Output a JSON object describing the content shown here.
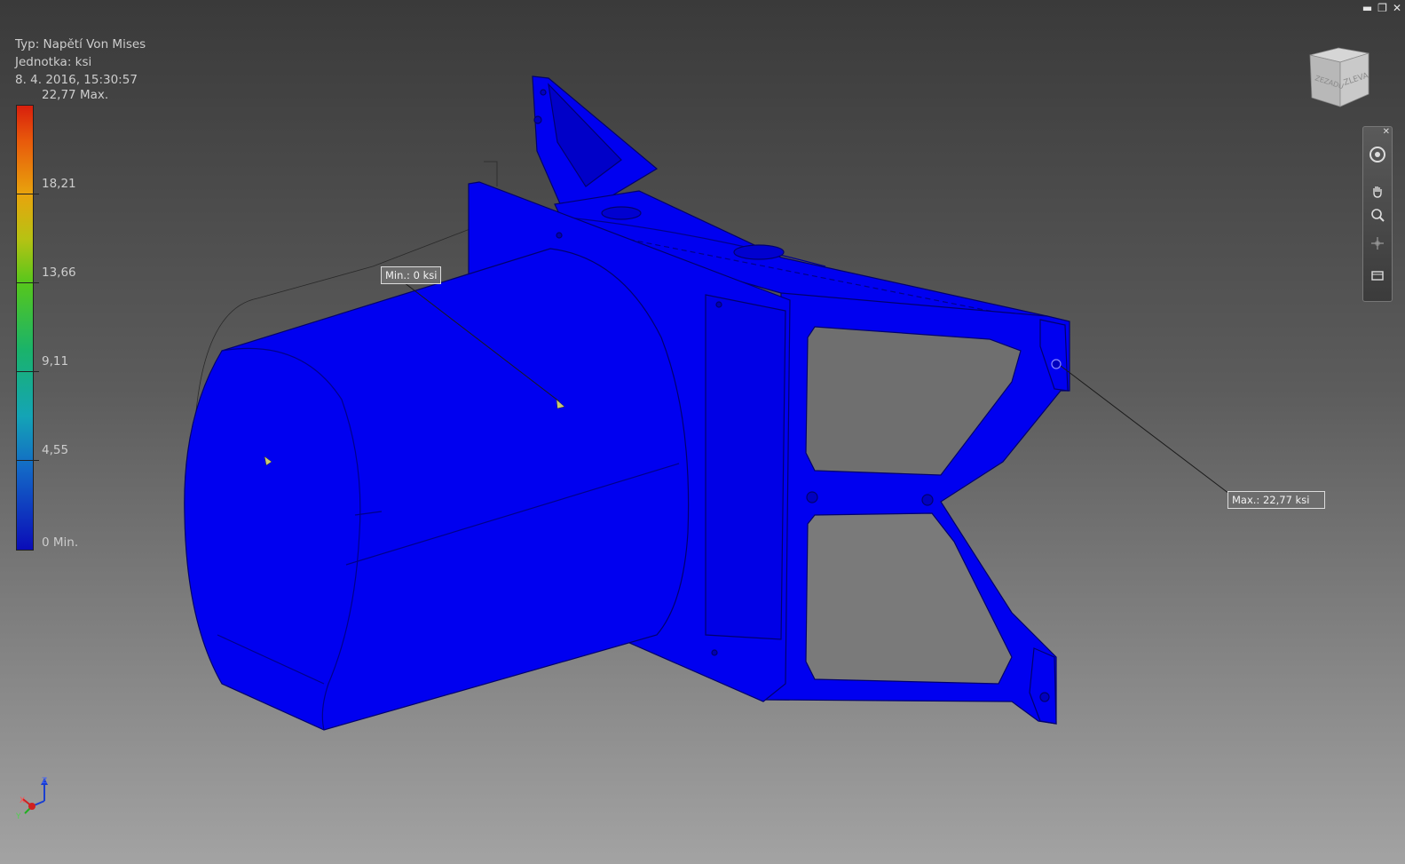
{
  "window": {
    "minimize": "▬",
    "restore": "❐",
    "close": "✕"
  },
  "legend": {
    "type_label": "Typ: Napětí Von Mises",
    "unit_label": "Jednotka: ksi",
    "timestamp": "8. 4. 2016, 15:30:57",
    "ticks": [
      "22,77 Max.",
      "18,21",
      "13,66",
      "9,11",
      "4,55",
      "0 Min."
    ]
  },
  "viewcube": {
    "face_back": "ZEZADU",
    "face_left": "ZLEVA"
  },
  "navbar": {
    "icons": [
      "steering-wheel-icon",
      "pan-icon",
      "zoom-icon",
      "orbit-icon",
      "look-at-icon"
    ]
  },
  "probes": {
    "min_label": "Min.: 0 ksi",
    "max_label": "Max.: 22,77 ksi"
  },
  "triad": {
    "x": "X",
    "y": "Y",
    "z": "Z"
  },
  "colors": {
    "model_fill": "#0000f0",
    "model_edge": "#00006e",
    "background_top": "#3a3a3a",
    "background_bottom": "#a3a3a3"
  }
}
